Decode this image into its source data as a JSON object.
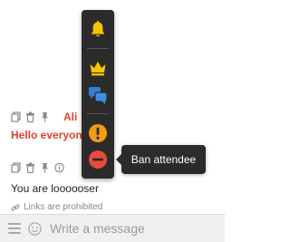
{
  "messages": [
    {
      "sender": "Ali",
      "text": "Hello everyon",
      "actions": [
        "copy-icon",
        "trash-icon",
        "pin-icon"
      ]
    },
    {
      "sender": "",
      "text": "You are loooooser",
      "actions": [
        "copy-icon",
        "trash-icon",
        "pin-icon",
        "info-icon"
      ]
    }
  ],
  "notice": {
    "icon": "link-icon",
    "text": "Links are prohibited"
  },
  "toolbar": {
    "buttons": [
      {
        "icon": "bell-icon",
        "color": "#f5c400"
      },
      {
        "icon": "crown-icon",
        "color": "#f5c400"
      },
      {
        "icon": "chat-bubbles-icon",
        "color": "#2f7fd3"
      },
      {
        "icon": "exclamation-icon",
        "color": "#f39c12"
      },
      {
        "icon": "ban-icon",
        "color": "#e74c3c"
      }
    ]
  },
  "tooltip": {
    "text": "Ban attendee"
  },
  "composer": {
    "menu_icon": "hamburger-icon",
    "emoji_icon": "smiley-icon",
    "placeholder": "Write a message"
  }
}
